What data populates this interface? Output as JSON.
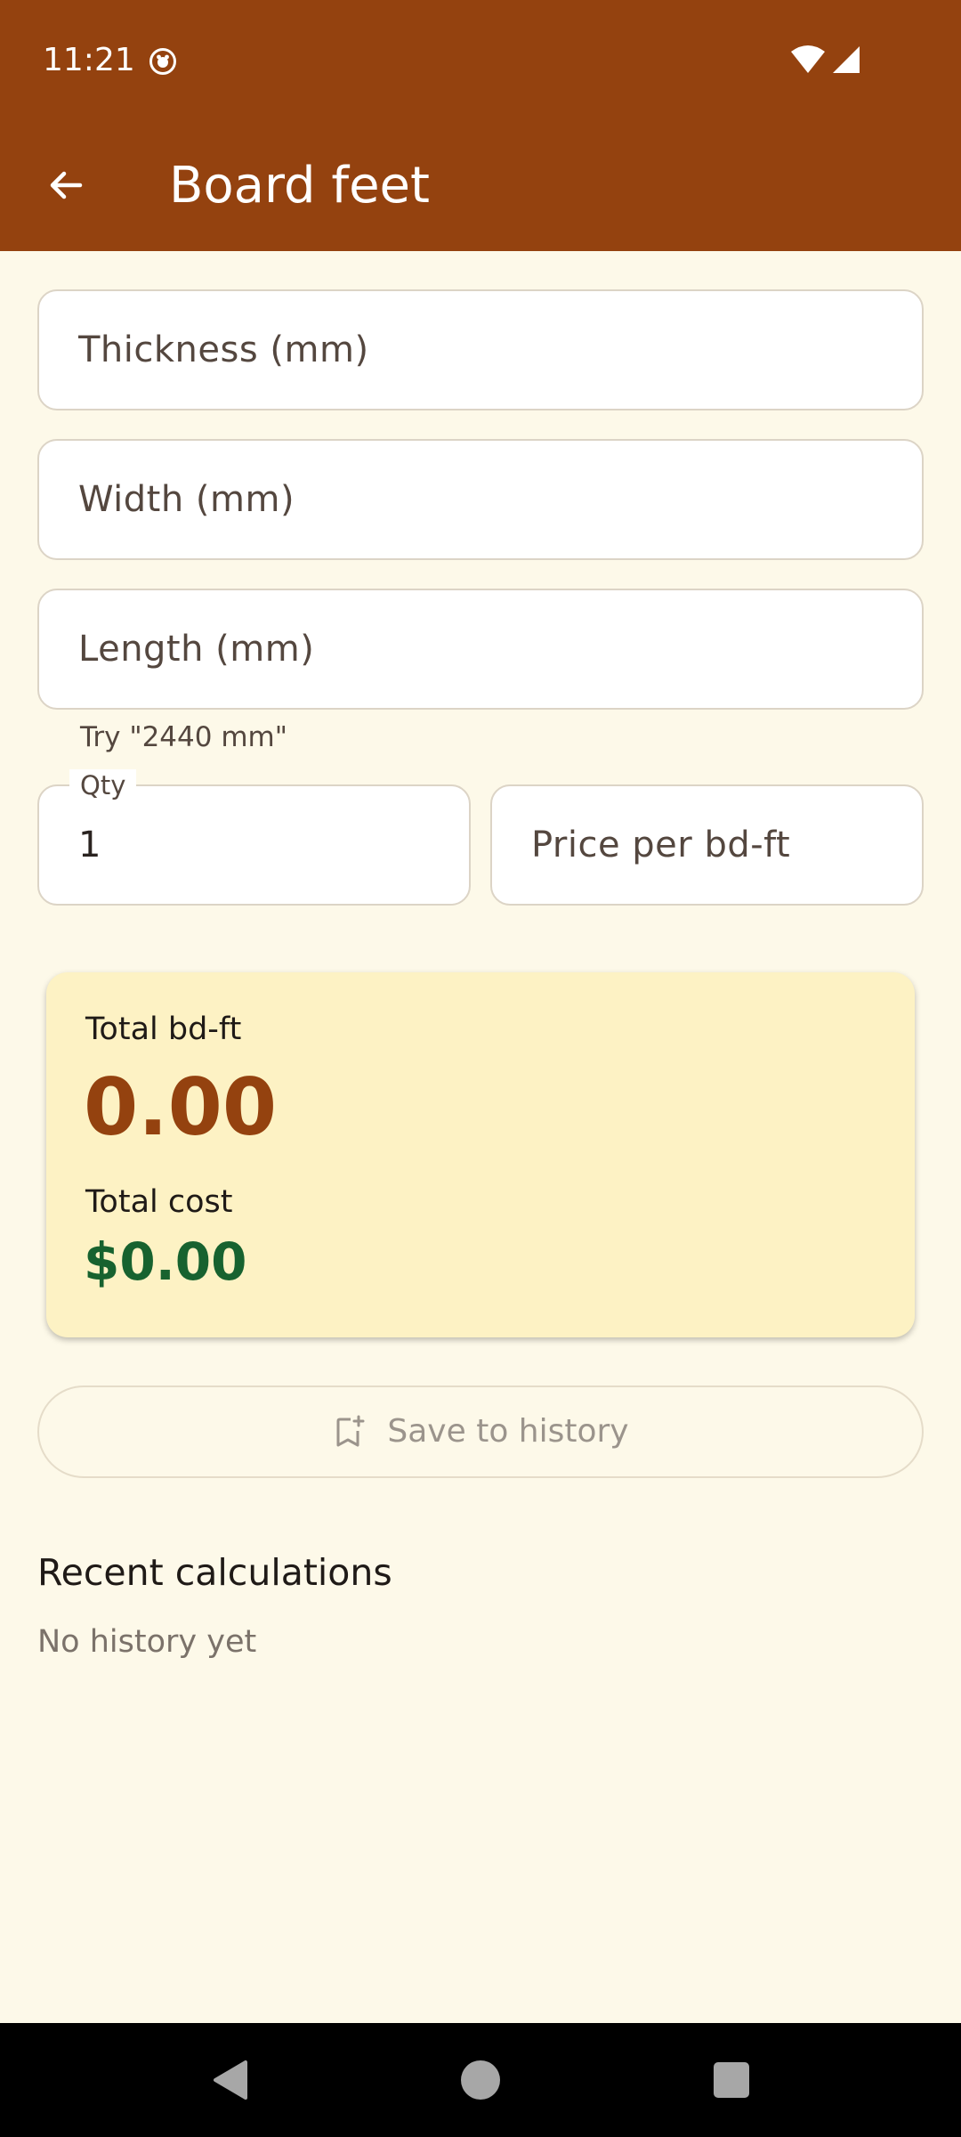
{
  "status_bar": {
    "time": "11:21",
    "icons": [
      "app-notification-icon",
      "wifi-icon",
      "cell-signal-icon"
    ]
  },
  "app_bar": {
    "title": "Board feet",
    "back_icon": "arrow-back-icon"
  },
  "form": {
    "thickness": {
      "placeholder": "Thickness (mm)",
      "value": ""
    },
    "width": {
      "placeholder": "Width (mm)",
      "value": ""
    },
    "length": {
      "placeholder": "Length (mm)",
      "value": "",
      "helper": "Try \"2440 mm\""
    },
    "qty": {
      "label": "Qty",
      "value": "1"
    },
    "price": {
      "placeholder": "Price per bd-ft",
      "value": ""
    }
  },
  "result": {
    "bdft_label": "Total bd-ft",
    "bdft_value": "0.00",
    "cost_label": "Total cost",
    "cost_value": "$0.00"
  },
  "save": {
    "label": "Save to history",
    "icon": "bookmark-add-icon"
  },
  "history": {
    "heading": "Recent calculations",
    "empty": "No history yet"
  },
  "colors": {
    "primary": "#94420f",
    "background": "#fdf9e9",
    "card": "#fdf2c4",
    "cost_green": "#17622f"
  }
}
